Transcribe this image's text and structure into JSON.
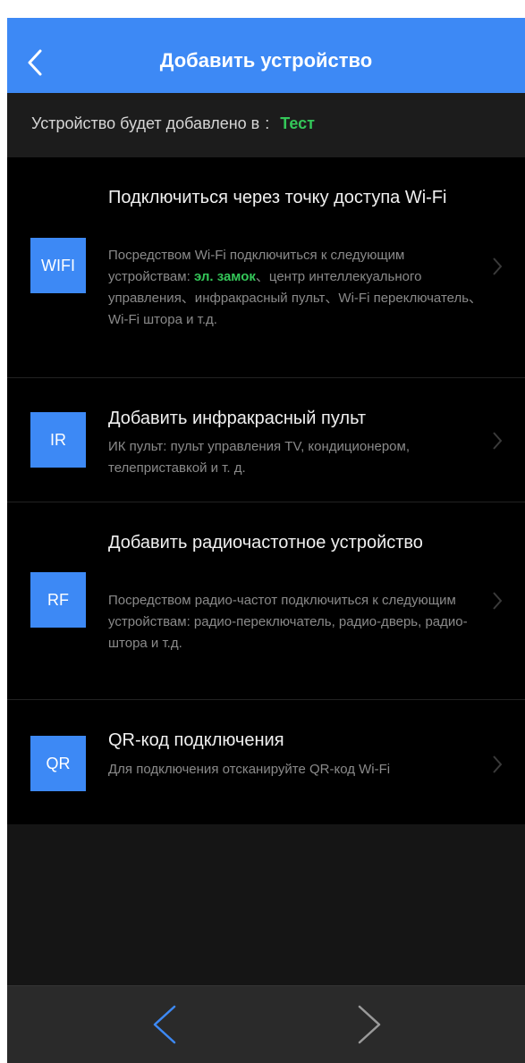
{
  "header": {
    "title": "Добавить устройство"
  },
  "target": {
    "label": "Устройство будет добавлено в",
    "colon": ":",
    "value": "Тест"
  },
  "items": [
    {
      "icon": "WIFI",
      "title": "Подключиться через точку доступа Wi-Fi",
      "desc_before": "Посредством Wi-Fi подключиться к следующим устройствам: ",
      "desc_highlight": "эл. замок",
      "desc_after": "、центр интеллекуального управления、инфракрасный пульт、Wi-Fi переключатель、Wi-Fi штора и т.д."
    },
    {
      "icon": "IR",
      "title": "Добавить инфракрасный пульт",
      "desc": "ИК пульт: пульт управления TV, кондиционером, телеприставкой и т. д."
    },
    {
      "icon": "RF",
      "title": "Добавить радиочастотное устройство",
      "desc": "Посредством радио-частот подключиться к следующим устройствам: радио-переключатель, радио-дверь, радио-штора и т.д."
    },
    {
      "icon": "QR",
      "title": "QR-код подключения",
      "desc": "Для подключения отсканируйте QR-код Wi-Fi"
    }
  ],
  "colors": {
    "accent": "#3d89f5",
    "highlight": "#34c759",
    "background": "#000000"
  },
  "icons": {
    "back": "chevron-left-icon",
    "chevron": "chevron-right-icon",
    "nav_back": "nav-back-icon",
    "nav_forward": "nav-forward-icon"
  }
}
